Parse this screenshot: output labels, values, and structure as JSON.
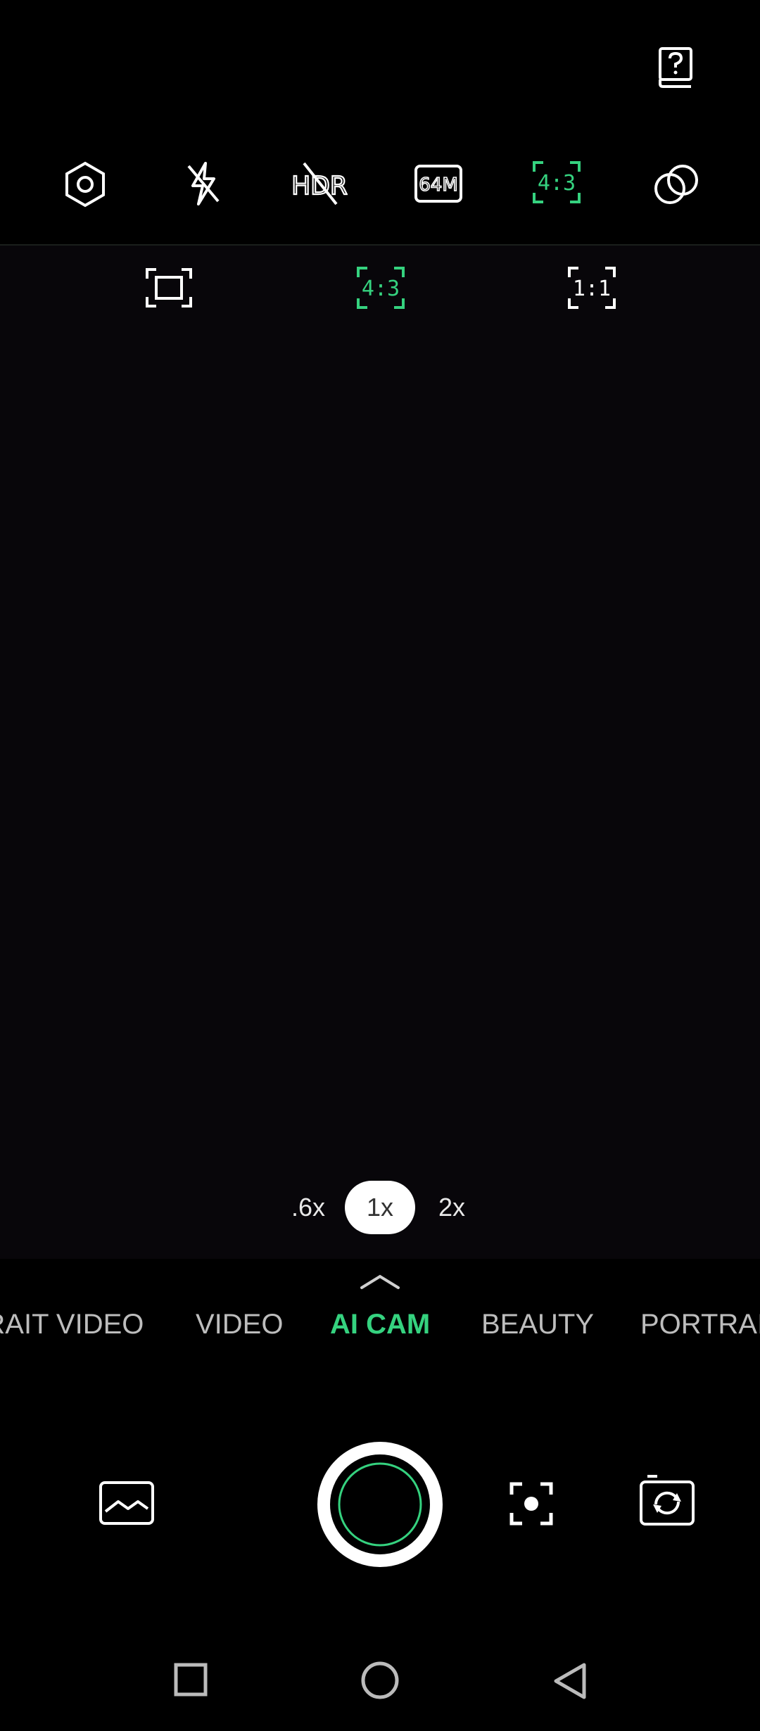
{
  "top": {
    "help_icon": "help-book-icon"
  },
  "toolbar": {
    "icons": [
      "settings-icon",
      "flash-off-icon",
      "hdr-off-icon",
      "resolution-64m-icon",
      "aspect-ratio-icon",
      "filter-icon"
    ],
    "hdr_label": "HDR",
    "resolution_label": "64M",
    "ratio_label": "4:3"
  },
  "ratio_options": {
    "full": "",
    "four_three": "4:3",
    "one_one": "1:1"
  },
  "zoom": {
    "wide": ".6x",
    "normal": "1x",
    "tele": "2x"
  },
  "modes": {
    "portrait_video": "PORTRAIT VIDEO",
    "video": "VIDEO",
    "ai_cam": "AI CAM",
    "beauty": "BEAUTY",
    "portrait": "PORTRAIT"
  },
  "colors": {
    "accent": "#35d27f",
    "background": "#000000",
    "viewfinder": "#08060a"
  }
}
